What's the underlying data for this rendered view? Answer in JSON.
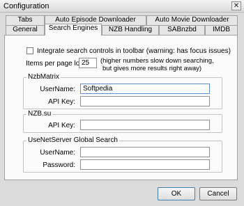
{
  "window": {
    "title": "Configuration",
    "close_glyph": "✕"
  },
  "tabs": {
    "row1": [
      "Tabs",
      "Auto Episode Downloader",
      "Auto Movie Downloader"
    ],
    "row2": [
      "General",
      "Search Engines",
      "NZB Handling",
      "SABnzbd",
      "IMDB"
    ],
    "active": "Search Engines"
  },
  "options": {
    "integrate_label": "Integrate search controls in toolbar (warning: has focus issues)",
    "integrate_checked": false,
    "items_per_page_label": "Items per page load:",
    "items_per_page_value": "25",
    "items_per_page_note_1": "(higher numbers slow down searching,",
    "items_per_page_note_2": "but gives more results right away)"
  },
  "nzbmatrix": {
    "title": "NzbMatrix",
    "username_label": "UserName:",
    "username_value": "Softpedia",
    "apikey_label": "API Key:",
    "apikey_value": ""
  },
  "nzbsu": {
    "title": "NZB.su",
    "apikey_label": "API Key:",
    "apikey_value": ""
  },
  "usenetserver": {
    "title": "UseNetServer Global Search",
    "username_label": "UserName:",
    "username_value": "",
    "password_label": "Password:",
    "password_value": ""
  },
  "buttons": {
    "ok": "OK",
    "cancel": "Cancel"
  }
}
